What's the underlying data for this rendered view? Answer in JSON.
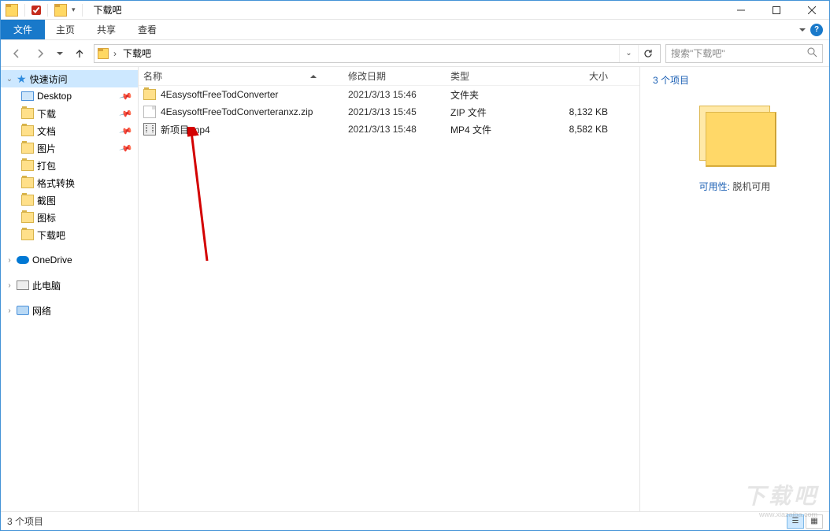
{
  "title": "下载吧",
  "ribbon": {
    "file": "文件",
    "tabs": [
      "主页",
      "共享",
      "查看"
    ]
  },
  "address": {
    "folder_name": "下载吧",
    "search_placeholder": "搜索\"下载吧\""
  },
  "sidebar": {
    "quick_access": "快速访问",
    "quick_items": [
      {
        "label": "Desktop",
        "pinned": true
      },
      {
        "label": "下载",
        "pinned": true
      },
      {
        "label": "文档",
        "pinned": true
      },
      {
        "label": "图片",
        "pinned": true
      },
      {
        "label": "打包",
        "pinned": false
      },
      {
        "label": "格式转换",
        "pinned": false
      },
      {
        "label": "截图",
        "pinned": false
      },
      {
        "label": "图标",
        "pinned": false
      },
      {
        "label": "下载吧",
        "pinned": false
      }
    ],
    "onedrive": "OneDrive",
    "this_pc": "此电脑",
    "network": "网络"
  },
  "columns": {
    "name": "名称",
    "date": "修改日期",
    "type": "类型",
    "size": "大小"
  },
  "rows": [
    {
      "icon": "folder",
      "name": "4EasysoftFreeTodConverter",
      "date": "2021/3/13 15:46",
      "type": "文件夹",
      "size": ""
    },
    {
      "icon": "file",
      "name": "4EasysoftFreeTodConverteranxz.zip",
      "date": "2021/3/13 15:45",
      "type": "ZIP 文件",
      "size": "8,132 KB"
    },
    {
      "icon": "video",
      "name": "新项目.mp4",
      "date": "2021/3/13 15:48",
      "type": "MP4 文件",
      "size": "8,582 KB"
    }
  ],
  "detail": {
    "title": "3 个项目",
    "avail_label": "可用性:",
    "avail_value": "脱机可用"
  },
  "status": {
    "text": "3 个项目"
  },
  "watermark": "下载吧",
  "watermark_url": "www.xiazaiba.com"
}
